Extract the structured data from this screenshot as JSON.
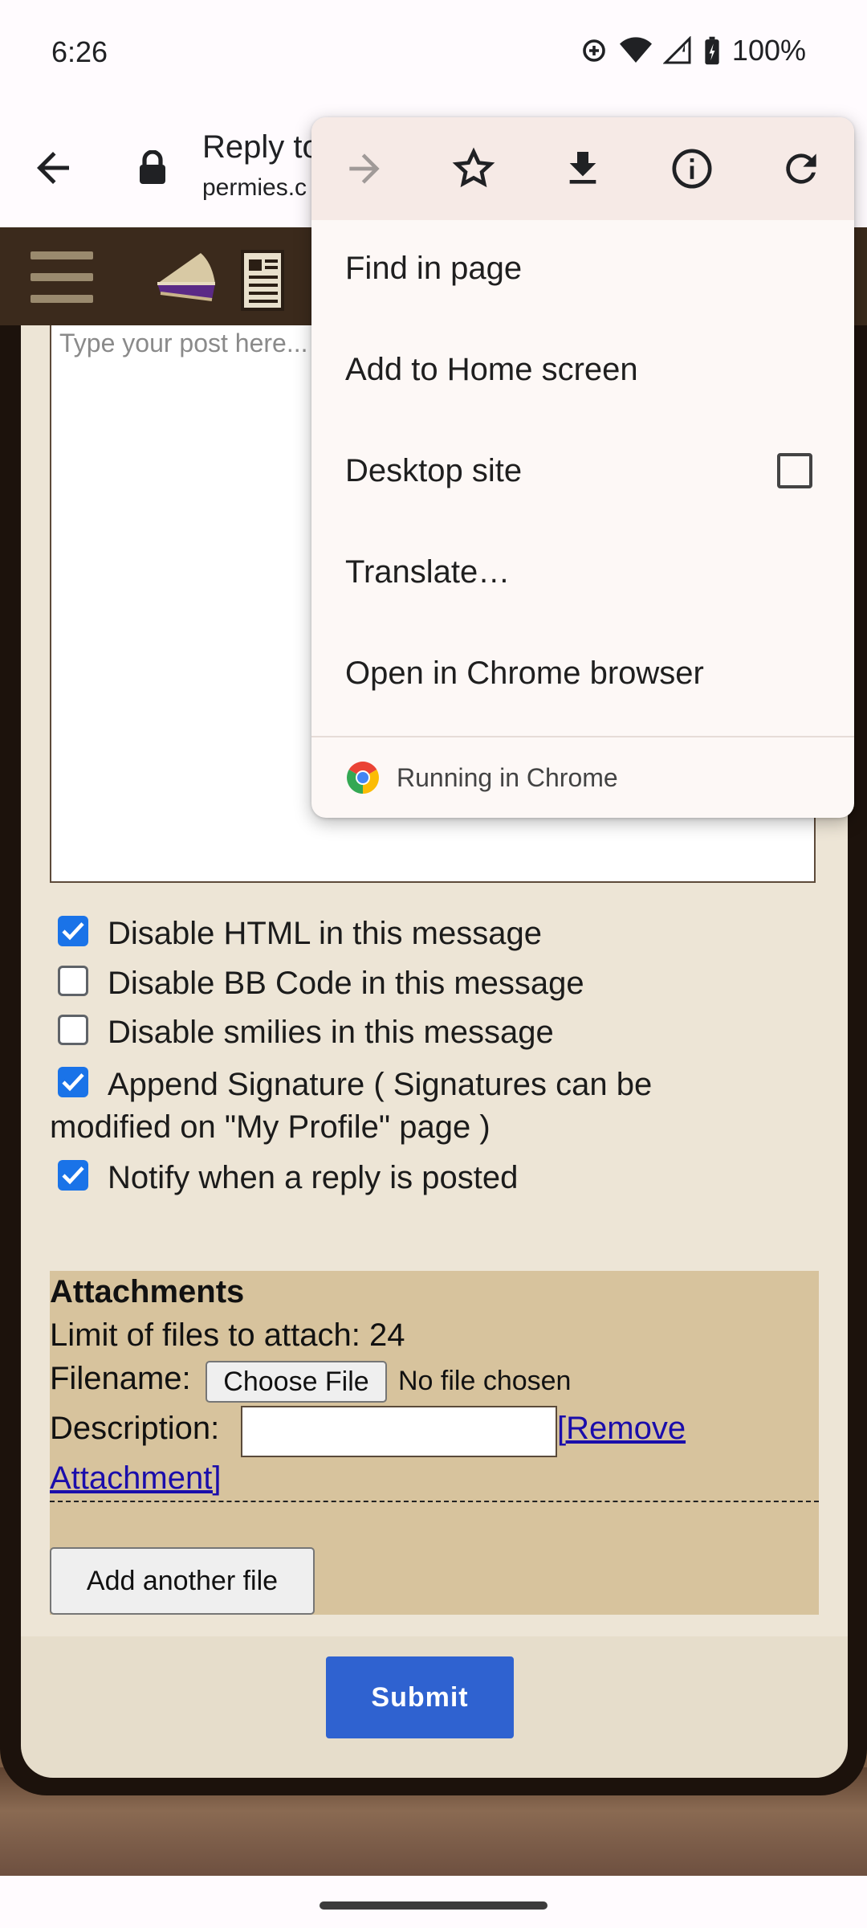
{
  "status_bar": {
    "time": "6:26",
    "battery": "100%"
  },
  "toolbar": {
    "title": "Reply to",
    "url": "permies.c"
  },
  "editor": {
    "placeholder": "Type your post here..."
  },
  "options": [
    {
      "label": "Disable HTML in this message",
      "checked": true
    },
    {
      "label": "Disable BB Code in this message",
      "checked": false
    },
    {
      "label": "Disable smilies in this message",
      "checked": false
    },
    {
      "label": "Append Signature ( Signatures can be",
      "label_cont": "modified on \"My Profile\" page )",
      "checked": true
    },
    {
      "label": "Notify when a reply is posted",
      "checked": true
    }
  ],
  "attachments": {
    "title": "Attachments",
    "limit": "Limit of files to attach: 24",
    "filename_label": "Filename:",
    "choose_file": "Choose File",
    "no_file": "No file chosen",
    "description_label": "Description:",
    "remove_link_part1": "[Remove",
    "remove_link_part2": "Attachment]",
    "add_file": "Add another file"
  },
  "submit_label": "Submit",
  "chrome_menu": {
    "icons": [
      "forward-arrow-icon",
      "star-icon",
      "download-icon",
      "info-icon",
      "refresh-icon"
    ],
    "items": [
      "Find in page",
      "Add to Home screen",
      "Desktop site",
      "Translate…",
      "Open in Chrome browser"
    ],
    "desktop_site_checked": false,
    "footer": "Running in Chrome"
  },
  "colors": {
    "accent": "#1a73e8",
    "submit": "#2f62d0",
    "site_header": "#3b2a1c",
    "attachments_bg": "#d7c39d",
    "link": "#1a0dab"
  }
}
